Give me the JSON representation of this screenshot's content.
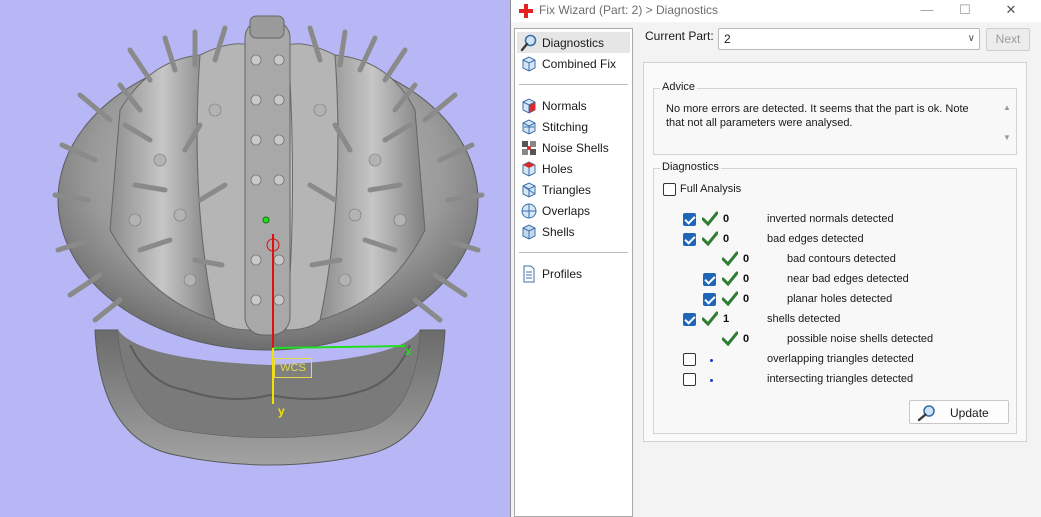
{
  "window": {
    "title": "Fix Wizard (Part: 2) > Diagnostics",
    "controls": {
      "minimize": "—",
      "maximize": "☐",
      "close": "✕"
    }
  },
  "viewport": {
    "wcs_label": "WCS",
    "x_label": "x",
    "y_label": "y"
  },
  "nav": {
    "items": [
      {
        "label": "Diagnostics",
        "icon": "magnifier-icon",
        "selected": true
      },
      {
        "label": "Combined Fix",
        "icon": "cube-icon"
      },
      {
        "label": "Normals",
        "icon": "normals-cube-icon"
      },
      {
        "label": "Stitching",
        "icon": "stitching-cube-icon"
      },
      {
        "label": "Noise Shells",
        "icon": "noise-shells-icon"
      },
      {
        "label": "Holes",
        "icon": "holes-cube-icon"
      },
      {
        "label": "Triangles",
        "icon": "triangles-cube-icon"
      },
      {
        "label": "Overlaps",
        "icon": "overlaps-icon"
      },
      {
        "label": "Shells",
        "icon": "shells-cube-icon"
      },
      {
        "label": "Profiles",
        "icon": "document-icon"
      }
    ]
  },
  "current_part": {
    "label": "Current Part:",
    "value": "2",
    "next_label": "Next"
  },
  "advice": {
    "title": "Advice",
    "text": "No more errors are detected. It seems that the part is ok. Note that not all parameters were analysed."
  },
  "diagnostics": {
    "title": "Diagnostics",
    "full_analysis_label": "Full Analysis",
    "full_analysis_checked": false,
    "rows": [
      {
        "checkbox": true,
        "checked": true,
        "status": "ok",
        "count": "0",
        "label": "inverted normals detected",
        "indent": 0
      },
      {
        "checkbox": true,
        "checked": true,
        "status": "ok",
        "count": "0",
        "label": "bad edges detected",
        "indent": 0
      },
      {
        "checkbox": false,
        "checked": false,
        "status": "ok",
        "count": "0",
        "label": "bad contours detected",
        "indent": 1
      },
      {
        "checkbox": true,
        "checked": true,
        "status": "ok",
        "count": "0",
        "label": "near bad edges detected",
        "indent": 1
      },
      {
        "checkbox": true,
        "checked": true,
        "status": "ok",
        "count": "0",
        "label": "planar holes detected",
        "indent": 1
      },
      {
        "checkbox": true,
        "checked": true,
        "status": "ok",
        "count": "1",
        "label": "shells detected",
        "indent": 0
      },
      {
        "checkbox": false,
        "checked": false,
        "status": "ok",
        "count": "0",
        "label": "possible noise shells detected",
        "indent": 1
      },
      {
        "checkbox": true,
        "checked": false,
        "status": "none",
        "count": "",
        "label": "overlapping triangles detected",
        "indent": 0
      },
      {
        "checkbox": true,
        "checked": false,
        "status": "none",
        "count": "",
        "label": "intersecting triangles detected",
        "indent": 0
      }
    ],
    "update_label": "Update"
  },
  "colors": {
    "viewport_bg": "#b7b7f5",
    "check_green": "#2e7d32",
    "checkbox_blue": "#1f66b8",
    "axis_x": "#22dd22",
    "axis_y": "#f2e200",
    "axis_z": "#dd1111"
  }
}
